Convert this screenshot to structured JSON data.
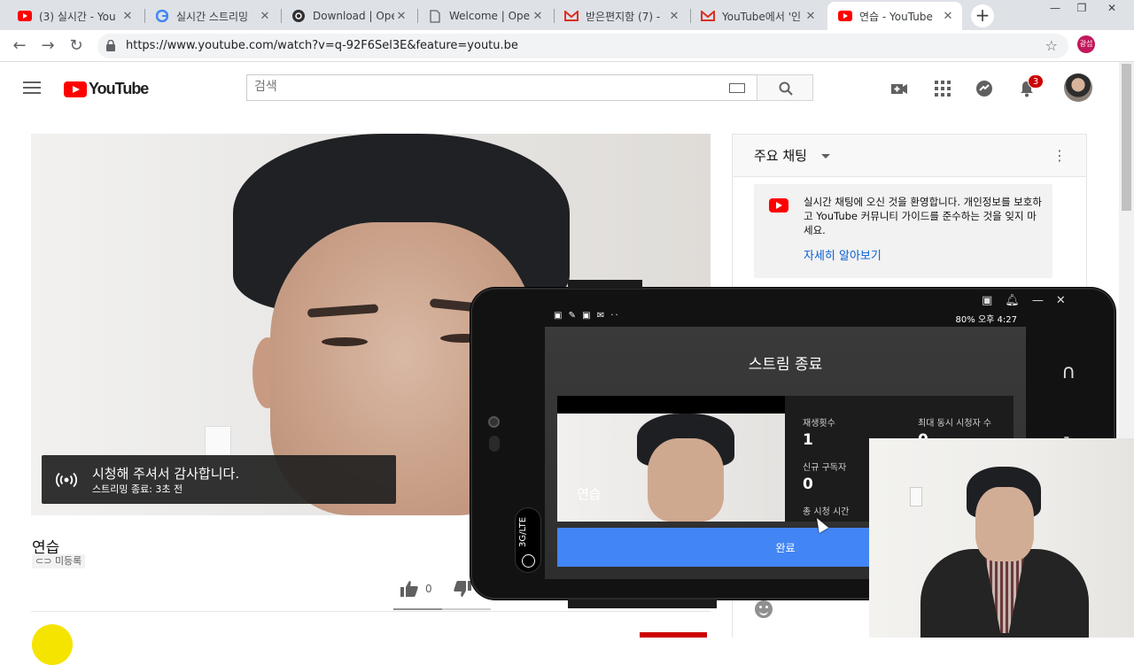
{
  "browser": {
    "tabs": [
      {
        "title": "(3) 실시간 - You",
        "icon": "youtube-icon",
        "active": false
      },
      {
        "title": "실시간 스트리밍",
        "icon": "google-icon",
        "active": false
      },
      {
        "title": "Download | Ope",
        "icon": "obs-icon",
        "active": false
      },
      {
        "title": "Welcome | Oper",
        "icon": "page-icon",
        "active": false
      },
      {
        "title": "받은편지함 (7) -",
        "icon": "gmail-icon",
        "active": false
      },
      {
        "title": "YouTube에서 '인",
        "icon": "gmail-icon",
        "active": false
      },
      {
        "title": "연습 - YouTube",
        "icon": "youtube-icon",
        "active": true
      }
    ],
    "close_glyph": "✕",
    "new_tab_glyph": "+",
    "url": "https://www.youtube.com/watch?v=q-92F6Sel3E&feature=youtu.be",
    "profile_label": "광섭"
  },
  "youtube": {
    "logo_text": "YouTube",
    "search_placeholder": "검색",
    "notification_count": "3"
  },
  "player": {
    "overlay_title": "시청해 주셔서 감사합니다.",
    "overlay_subtitle": "스트리밍 종료: 3초 전"
  },
  "video": {
    "title": "연습",
    "visibility": "미등록",
    "likes": "0"
  },
  "chat": {
    "mode_label": "주요 채팅",
    "welcome_text": "실시간 채팅에 오신 것을 환영합니다. 개인정보를 보호하고 YouTube 커뮤니티 가이드를 준수하는 것을 잊지 마세요.",
    "learn_more": "자세히 알아보기"
  },
  "phone": {
    "status_right": "80% 오후 4:27",
    "network_label": "3G/LTE",
    "screen_title": "스트림 종료",
    "thumb_title": "연습",
    "stats": {
      "views_label": "재생횟수",
      "views_value": "1",
      "max_concurrent_label": "최대 동시 시청자 수",
      "max_concurrent_value": "0",
      "new_subs_label": "신규 구독자",
      "new_subs_value": "0",
      "total_watch_label": "총 시청 시간"
    },
    "done_label": "완료"
  }
}
